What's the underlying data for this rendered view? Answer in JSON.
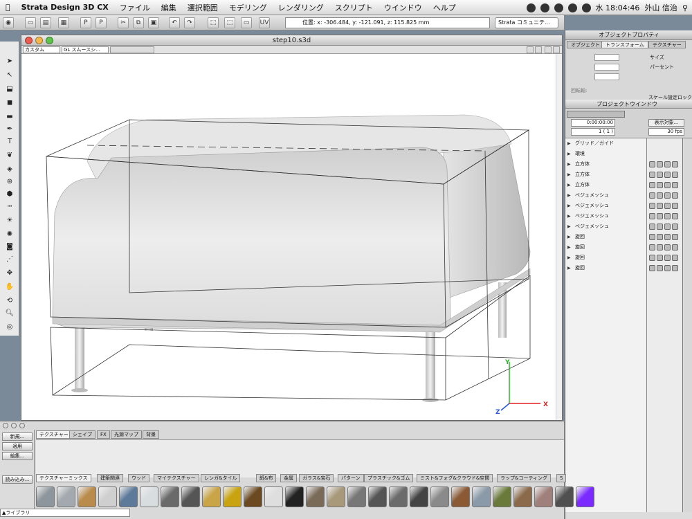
{
  "menubar": {
    "app": "Strata Design 3D CX",
    "items": [
      "ファイル",
      "編集",
      "選択範囲",
      "モデリング",
      "レンダリング",
      "スクリプト",
      "ウインドウ",
      "ヘルプ"
    ],
    "clock": "水 18:04:46",
    "user": "外山 信治"
  },
  "toolbar": {
    "coords": "位置: x: -306.484, y: -121.091, z: 115.825 mm",
    "community": "Strata コミュニテ..."
  },
  "view": {
    "title": "step10.s3d",
    "camera": "カスタム",
    "render_mode": "GL スムースシ..."
  },
  "axes": {
    "y": "Y",
    "x": "X",
    "z": "Z"
  },
  "objprop": {
    "title": "オブジェクトプロパティ",
    "tabs": [
      "オブジェクト",
      "トランスフォーム",
      "テクスチャー"
    ],
    "size_label": "サイズ",
    "percent_label": "パーセント",
    "pivot_label": "回転軸:",
    "scale_lock": "スケール設定ロック"
  },
  "project": {
    "title": "プロジェクトウインドウ",
    "display_button": "表示対象...",
    "time": "0:00:00:00",
    "frame": "1 ( 1 )",
    "fps": "30 fps",
    "rows": [
      "グリッド／ガイド",
      "環境",
      "立方体",
      "立方体",
      "立方体",
      "ベジェメッシュ",
      "ベジェメッシュ",
      "ベジェメッシュ",
      "ベジェメッシュ",
      "旋回",
      "旋回",
      "旋回",
      "旋回"
    ]
  },
  "library": {
    "buttons": [
      "新規...",
      "適用",
      "編集..."
    ],
    "load_button": "読み込み...",
    "tabs": [
      "テクスチャー",
      "シェイプ",
      "FX",
      "光源マップ",
      "背景"
    ],
    "material_tabs": [
      "テクスチャーミックス",
      "建築関連",
      "ウッド",
      "マイテクスチャー",
      "レンガ&タイル",
      "紙&布",
      "金属",
      "ガラス&宝石",
      "パターン",
      "プラスチック&ゴム",
      "ミスト&フォグ&クラウド&空間",
      "ラップ&コーティング",
      "S"
    ],
    "swatch_colors": [
      "#8c969c",
      "#a3a9ae",
      "#b98c4b",
      "#cfcfcf",
      "#5d7a9a",
      "#d8dde0",
      "#6a6a6a",
      "#555",
      "#c9a547",
      "#c9a410",
      "#6b4a22",
      "#dedede",
      "#222",
      "#7a6a58",
      "#a8997a",
      "#777",
      "#555",
      "#6b6b6b",
      "#444",
      "#8a8a8a",
      "#8b5a35",
      "#8a9aa8",
      "#6a7a3a",
      "#8a6a4a",
      "#a0807a",
      "#505050",
      "#7a2aff"
    ],
    "library_select": "▲ライブラリ"
  }
}
